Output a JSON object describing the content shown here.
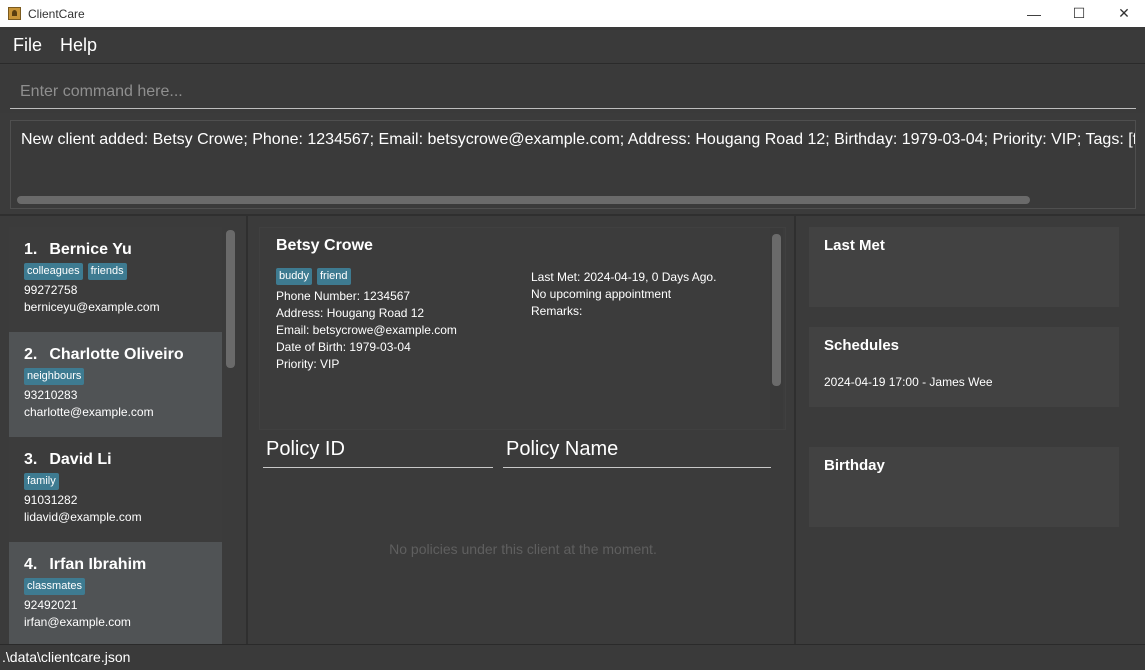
{
  "window": {
    "title": "ClientCare",
    "minimize_glyph": "—",
    "maximize_glyph": "☐",
    "close_glyph": "✕"
  },
  "menu": {
    "file": "File",
    "help": "Help"
  },
  "command": {
    "placeholder": "Enter command here..."
  },
  "result": {
    "text": "New client added: Betsy Crowe; Phone: 1234567; Email: betsycrowe@example.com; Address: Hougang Road 12; Birthday: 1979-03-04; Priority: VIP; Tags: [f"
  },
  "clients": [
    {
      "index": "1.",
      "name": "Bernice Yu",
      "tags": [
        "colleagues",
        "friends"
      ],
      "phone": "99272758",
      "email": "berniceyu@example.com"
    },
    {
      "index": "2.",
      "name": "Charlotte Oliveiro",
      "tags": [
        "neighbours"
      ],
      "phone": "93210283",
      "email": "charlotte@example.com"
    },
    {
      "index": "3.",
      "name": "David Li",
      "tags": [
        "family"
      ],
      "phone": "91031282",
      "email": "lidavid@example.com"
    },
    {
      "index": "4.",
      "name": "Irfan Ibrahim",
      "tags": [
        "classmates"
      ],
      "phone": "92492021",
      "email": "irfan@example.com"
    }
  ],
  "detail": {
    "name": "Betsy Crowe",
    "tags": [
      "buddy",
      "friend"
    ],
    "phone": "Phone Number: 1234567",
    "address": "Address: Hougang Road 12",
    "email": "Email: betsycrowe@example.com",
    "dob": "Date of Birth: 1979-03-04",
    "priority": "Priority: VIP",
    "last_met": "Last Met: 2024-04-19, 0 Days Ago.",
    "appointment": "No upcoming appointment",
    "remarks": "Remarks:"
  },
  "policies": {
    "col_id": "Policy ID",
    "col_name": "Policy Name",
    "empty": "No policies under this client at the moment."
  },
  "side": {
    "last_met_title": "Last Met",
    "schedules_title": "Schedules",
    "schedule_entry": "2024-04-19 17:00 - James Wee",
    "birthday_title": "Birthday"
  },
  "status": {
    "path": ".\\data\\clientcare.json"
  },
  "colors": {
    "background": "#3b3b3b",
    "tag": "#3e7b91",
    "selected_card": "#505355"
  }
}
